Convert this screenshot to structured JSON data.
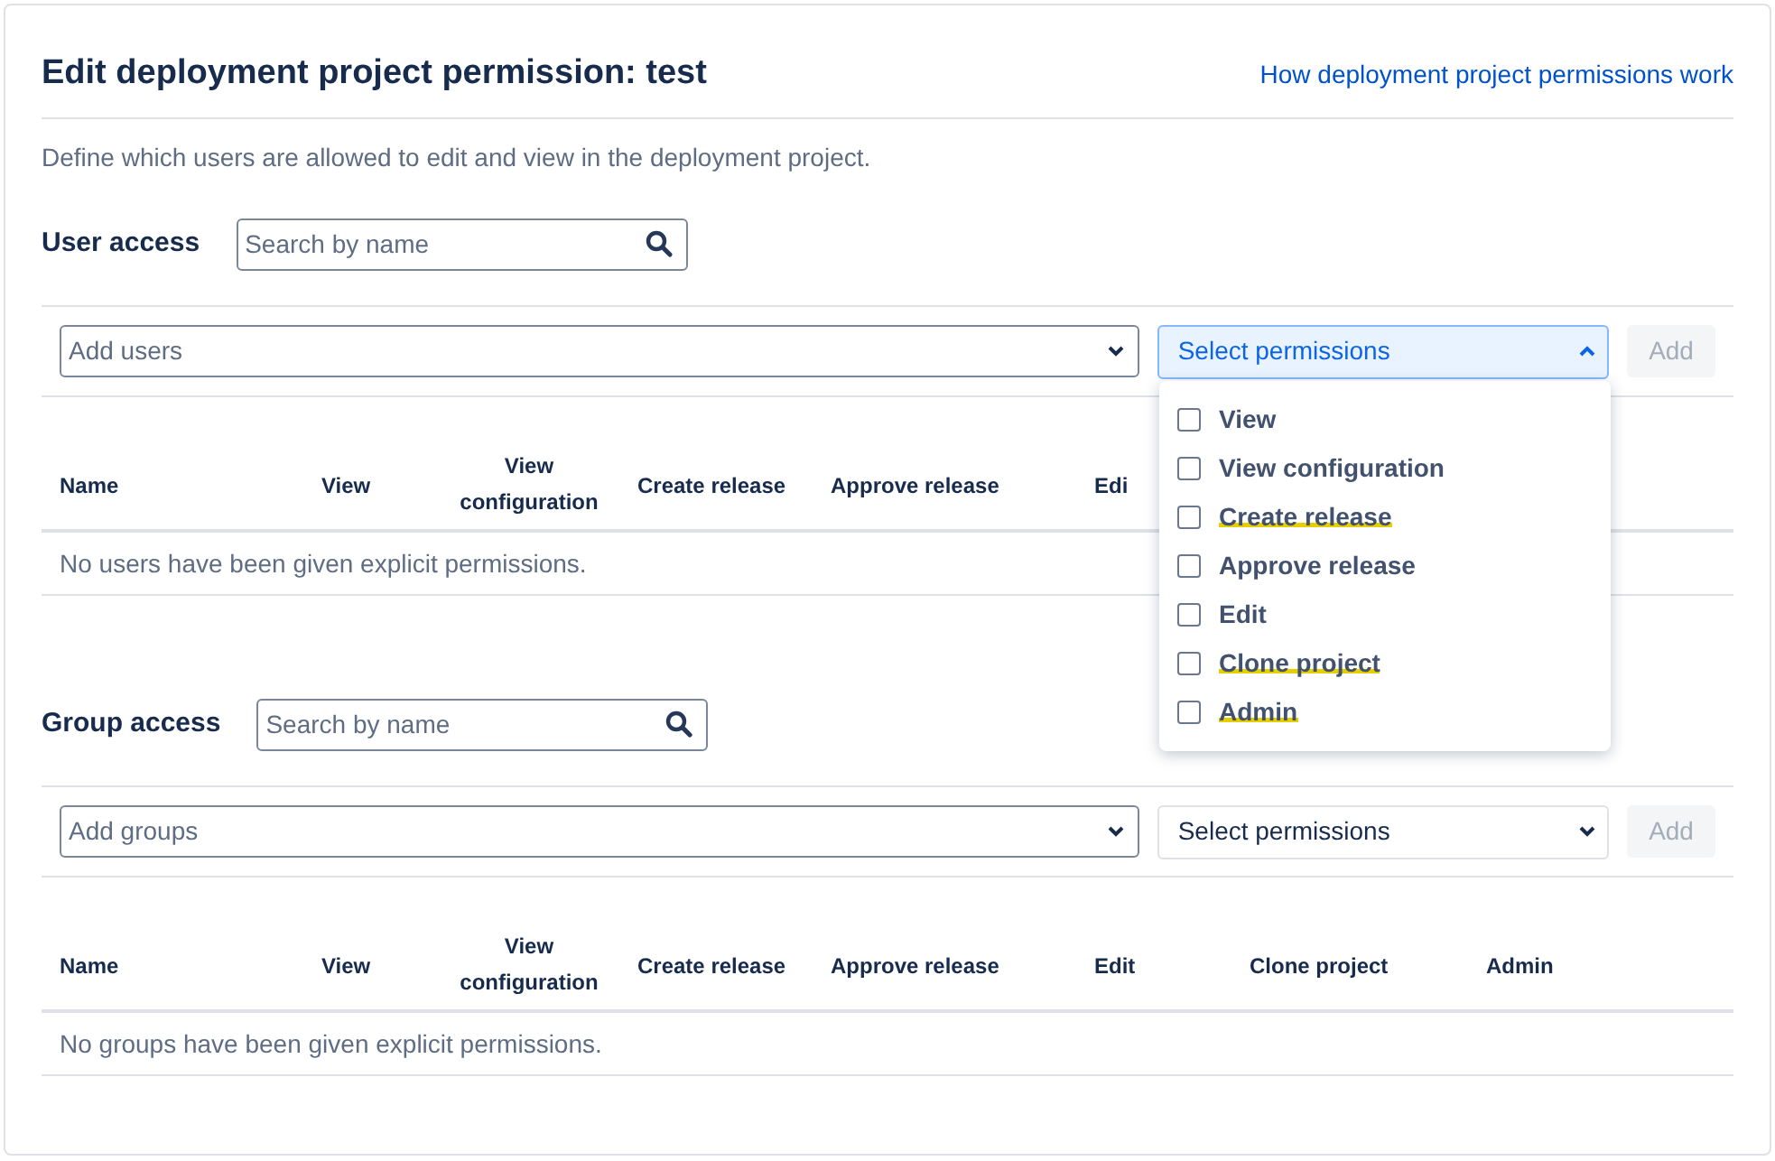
{
  "title": "Edit deployment project permission: test",
  "help_link": "How deployment project permissions work",
  "description": "Define which users are allowed to edit and view in the deployment project.",
  "sections": [
    {
      "heading": "User access",
      "search": {
        "placeholder": "Search by name"
      },
      "add_select": {
        "placeholder": "Add users"
      },
      "permissions_select": {
        "label": "Select permissions",
        "expanded": true,
        "options": [
          {
            "label": "View",
            "checked": false,
            "marked": false
          },
          {
            "label": "View configuration",
            "checked": false,
            "marked": false
          },
          {
            "label": "Create release",
            "checked": false,
            "marked": true
          },
          {
            "label": "Approve release",
            "checked": false,
            "marked": false
          },
          {
            "label": "Edit",
            "checked": false,
            "marked": false
          },
          {
            "label": "Clone project",
            "checked": false,
            "marked": true
          },
          {
            "label": "Admin",
            "checked": false,
            "marked": true
          }
        ]
      },
      "add_button": {
        "label": "Add",
        "disabled": true
      },
      "columns": [
        "Name",
        "View",
        "View configuration",
        "Create release",
        "Approve release",
        "Edi"
      ],
      "empty_message": "No users have been given explicit permissions."
    },
    {
      "heading": "Group access",
      "search": {
        "placeholder": "Search by name"
      },
      "add_select": {
        "placeholder": "Add groups"
      },
      "permissions_select": {
        "label": "Select permissions",
        "expanded": false
      },
      "add_button": {
        "label": "Add",
        "disabled": true
      },
      "columns": [
        "Name",
        "View",
        "View configuration",
        "Create release",
        "Approve release",
        "Edit",
        "Clone project",
        "Admin"
      ],
      "empty_message": "No groups have been given explicit permissions."
    }
  ]
}
